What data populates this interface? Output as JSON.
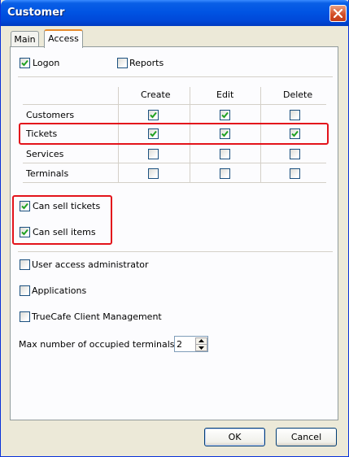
{
  "window": {
    "title": "Customer"
  },
  "tabs": [
    {
      "label": "Main",
      "active": false
    },
    {
      "label": "Access",
      "active": true
    }
  ],
  "top_checkboxes": [
    {
      "label": "Logon",
      "checked": true
    },
    {
      "label": "Reports",
      "checked": false
    }
  ],
  "permissions": {
    "columns": [
      "Create",
      "Edit",
      "Delete"
    ],
    "rows": [
      {
        "name": "Customers",
        "create": true,
        "edit": true,
        "delete": false
      },
      {
        "name": "Tickets",
        "create": true,
        "edit": true,
        "delete": true
      },
      {
        "name": "Services",
        "create": false,
        "edit": false,
        "delete": false
      },
      {
        "name": "Terminals",
        "create": false,
        "edit": false,
        "delete": false
      }
    ]
  },
  "sell_options": [
    {
      "label": "Can sell tickets",
      "checked": true
    },
    {
      "label": "Can sell items",
      "checked": true
    }
  ],
  "admin_options": [
    {
      "label": "User access administrator",
      "checked": false
    },
    {
      "label": "Applications",
      "checked": false
    },
    {
      "label": "TrueCafe Client Management",
      "checked": false
    }
  ],
  "max_terminals": {
    "label": "Max number of occupied terminals",
    "value": "2"
  },
  "buttons": {
    "ok": "OK",
    "cancel": "Cancel"
  },
  "highlight_color": "#e3131b",
  "check_color": "#21a121",
  "icons": {
    "close": "close-x-icon",
    "check": "checkmark-icon",
    "spin_up": "arrow-up-icon",
    "spin_down": "arrow-down-icon"
  }
}
